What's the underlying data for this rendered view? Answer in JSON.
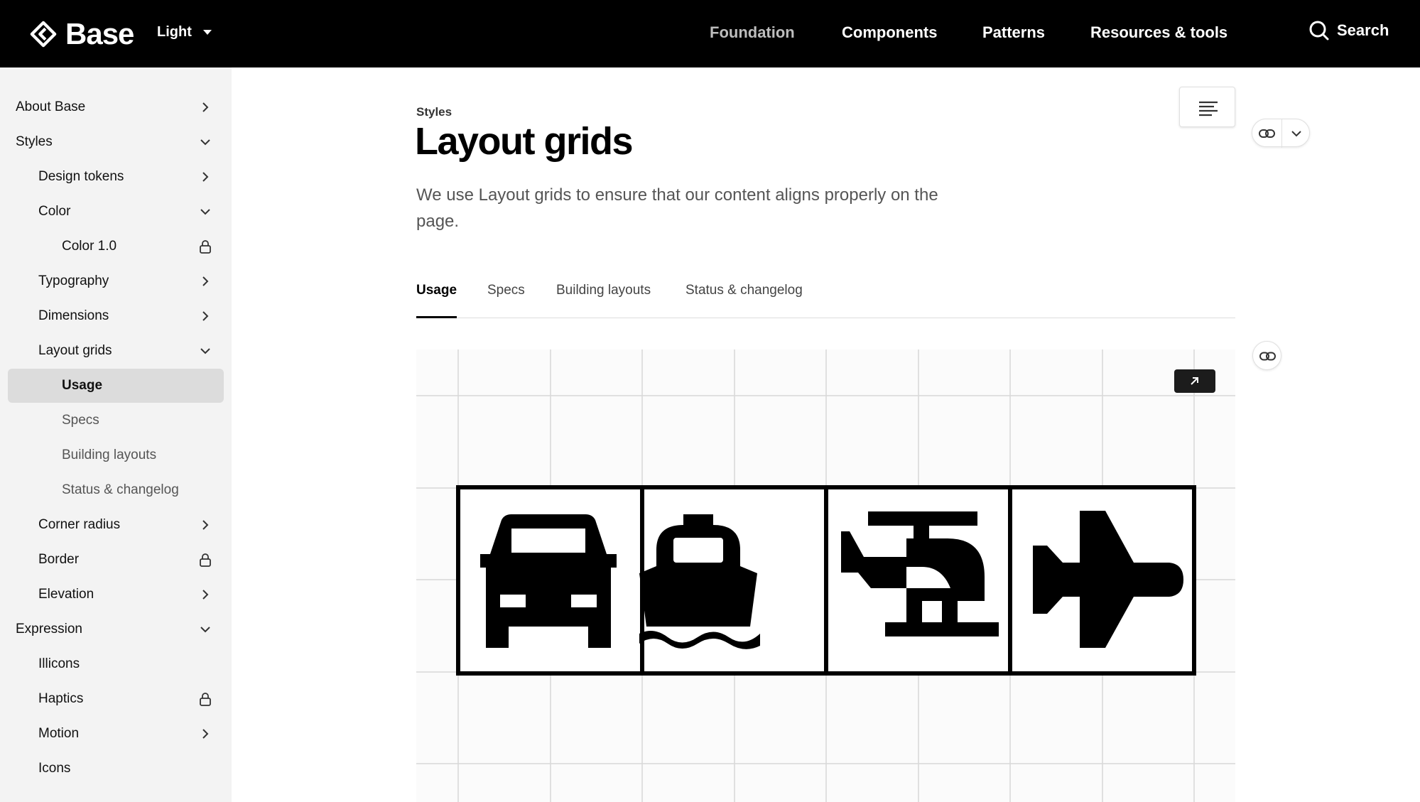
{
  "header": {
    "brand": "Base",
    "theme": "Light",
    "nav": [
      {
        "label": "Foundation",
        "active": true
      },
      {
        "label": "Components",
        "active": false
      },
      {
        "label": "Patterns",
        "active": false
      },
      {
        "label": "Resources & tools",
        "active": false
      }
    ],
    "search_label": "Search"
  },
  "sidebar": {
    "items": [
      {
        "label": "About Base",
        "trail": "chevron-right"
      },
      {
        "label": "Styles",
        "trail": "chevron-down"
      },
      {
        "label": "Design tokens",
        "trail": "chevron-right"
      },
      {
        "label": "Color",
        "trail": "chevron-down"
      },
      {
        "label": "Color 1.0",
        "trail": "lock"
      },
      {
        "label": "Typography",
        "trail": "chevron-right"
      },
      {
        "label": "Dimensions",
        "trail": "chevron-right"
      },
      {
        "label": "Layout grids",
        "trail": "chevron-down"
      },
      {
        "label": "Usage",
        "trail": "",
        "selected": true
      },
      {
        "label": "Specs",
        "trail": ""
      },
      {
        "label": "Building layouts",
        "trail": ""
      },
      {
        "label": "Status & changelog",
        "trail": ""
      },
      {
        "label": "Corner radius",
        "trail": "chevron-right"
      },
      {
        "label": "Border",
        "trail": "lock"
      },
      {
        "label": "Elevation",
        "trail": "chevron-right"
      },
      {
        "label": "Expression",
        "trail": "chevron-down"
      },
      {
        "label": "Illicons",
        "trail": ""
      },
      {
        "label": "Haptics",
        "trail": "lock"
      },
      {
        "label": "Motion",
        "trail": "chevron-right"
      },
      {
        "label": "Icons",
        "trail": ""
      }
    ]
  },
  "main": {
    "breadcrumb": "Styles",
    "title": "Layout grids",
    "lead": "We use Layout grids to ensure that our content aligns properly on the page.",
    "tabs": [
      "Usage",
      "Specs",
      "Building layouts",
      "Status & changelog"
    ],
    "active_tab": "Usage"
  },
  "figure": {
    "icons": [
      "car-icon",
      "ship-icon",
      "helicopter-icon",
      "airplane-icon"
    ]
  }
}
